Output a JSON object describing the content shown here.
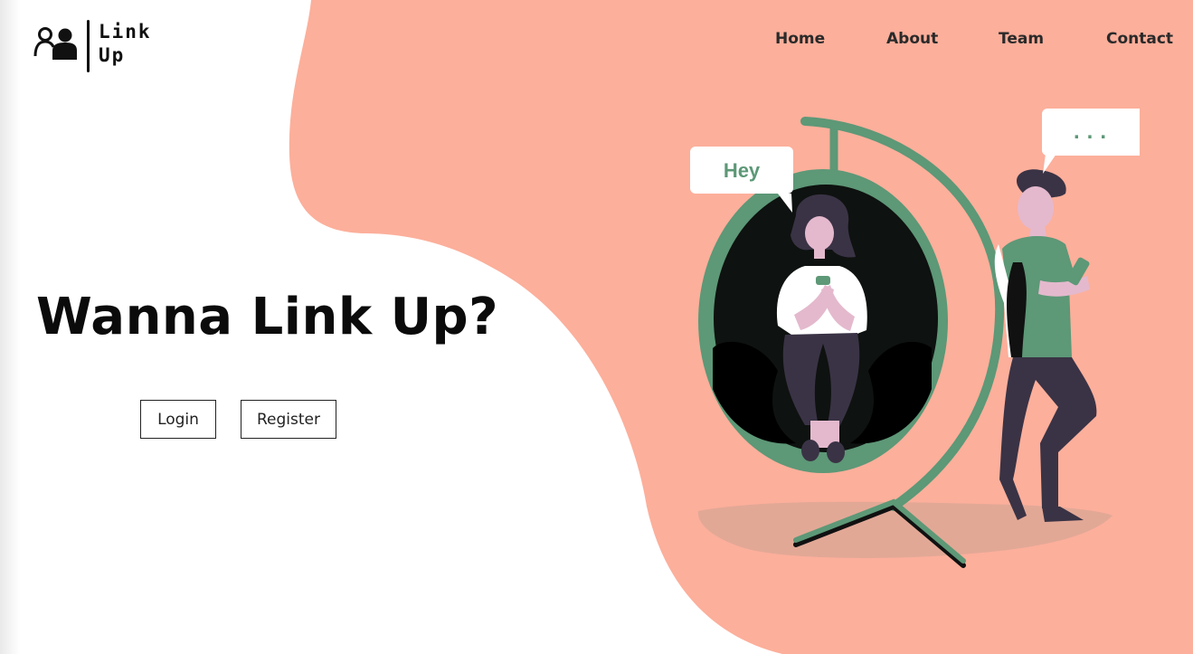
{
  "brand": {
    "logo_line1": "Link",
    "logo_line2": "Up"
  },
  "nav": {
    "items": [
      "Home",
      "About",
      "Team",
      "Contact"
    ]
  },
  "hero": {
    "title": "Wanna Link Up?",
    "login_label": "Login",
    "register_label": "Register"
  },
  "illustration": {
    "bubble_left": "Hey",
    "bubble_right": "..."
  },
  "colors": {
    "blob": "#fcaf9b",
    "accent_green": "#5d9877",
    "text_dark": "#0b0b0b"
  },
  "icons": [
    "people-logo-icon"
  ]
}
